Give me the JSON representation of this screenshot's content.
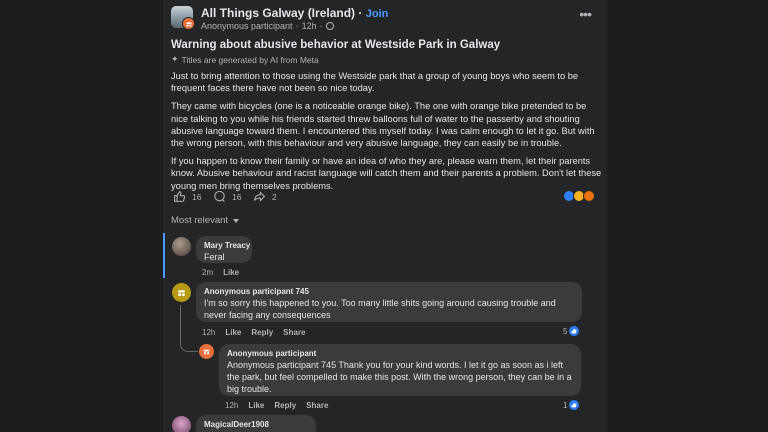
{
  "post": {
    "group_name": "All Things Galway (Ireland)",
    "separator": " · ",
    "join_label": "Join",
    "author": "Anonymous participant",
    "time": "12h",
    "title": "Warning about abusive behavior at Westside Park in Galway",
    "ai_note": "Titles are generated by AI from Meta",
    "paragraphs": [
      "Just to bring attention to those using the Westside park that a group of young boys who seem to be frequent faces there have not been so nice today.",
      "They came with bicycles (one is a noticeable orange bike). The one with orange bike pretended to be nice talking to you while his friends started threw balloons full of water to the passerby and shouting abusive language toward them. I encountered this myself today. I was calm enough to let it go. But with the wrong person, with this behaviour and very abusive language, they can easily be in trouble.",
      "If you happen to know their family or have an idea of who they are, please warn them, let their parents know. Abusive behaviour and racist language will catch them and their parents a problem. Don't let these young men bring themselves problems."
    ],
    "likes": "16",
    "comments": "16",
    "shares": "2",
    "sort_label": "Most relevant"
  },
  "comments": [
    {
      "author": "Mary Treacy",
      "text": "Feral",
      "time": "2m",
      "like": "Like"
    },
    {
      "author": "Anonymous participant 745",
      "text": "I'm so sorry this happened to you. Too many little shits going around causing trouble and never facing any consequences",
      "time": "12h",
      "like": "Like",
      "reply": "Reply",
      "share": "Share",
      "reactions": "5"
    },
    {
      "author": "Anonymous participant",
      "text": "Anonymous participant 745 Thank you for your kind words. I let it go as soon as i left the park, but feel compelled to make this post. With the wrong person, they can be in a big trouble.",
      "time": "12h",
      "like": "Like",
      "reply": "Reply",
      "share": "Share",
      "reactions": "1"
    },
    {
      "author": "MagicalDeer1908"
    }
  ],
  "colors": {
    "accent": "#4599ff",
    "bubble": "#3a3b3c",
    "anon": "#e8703a",
    "like_blue": "#2d7ef7"
  }
}
